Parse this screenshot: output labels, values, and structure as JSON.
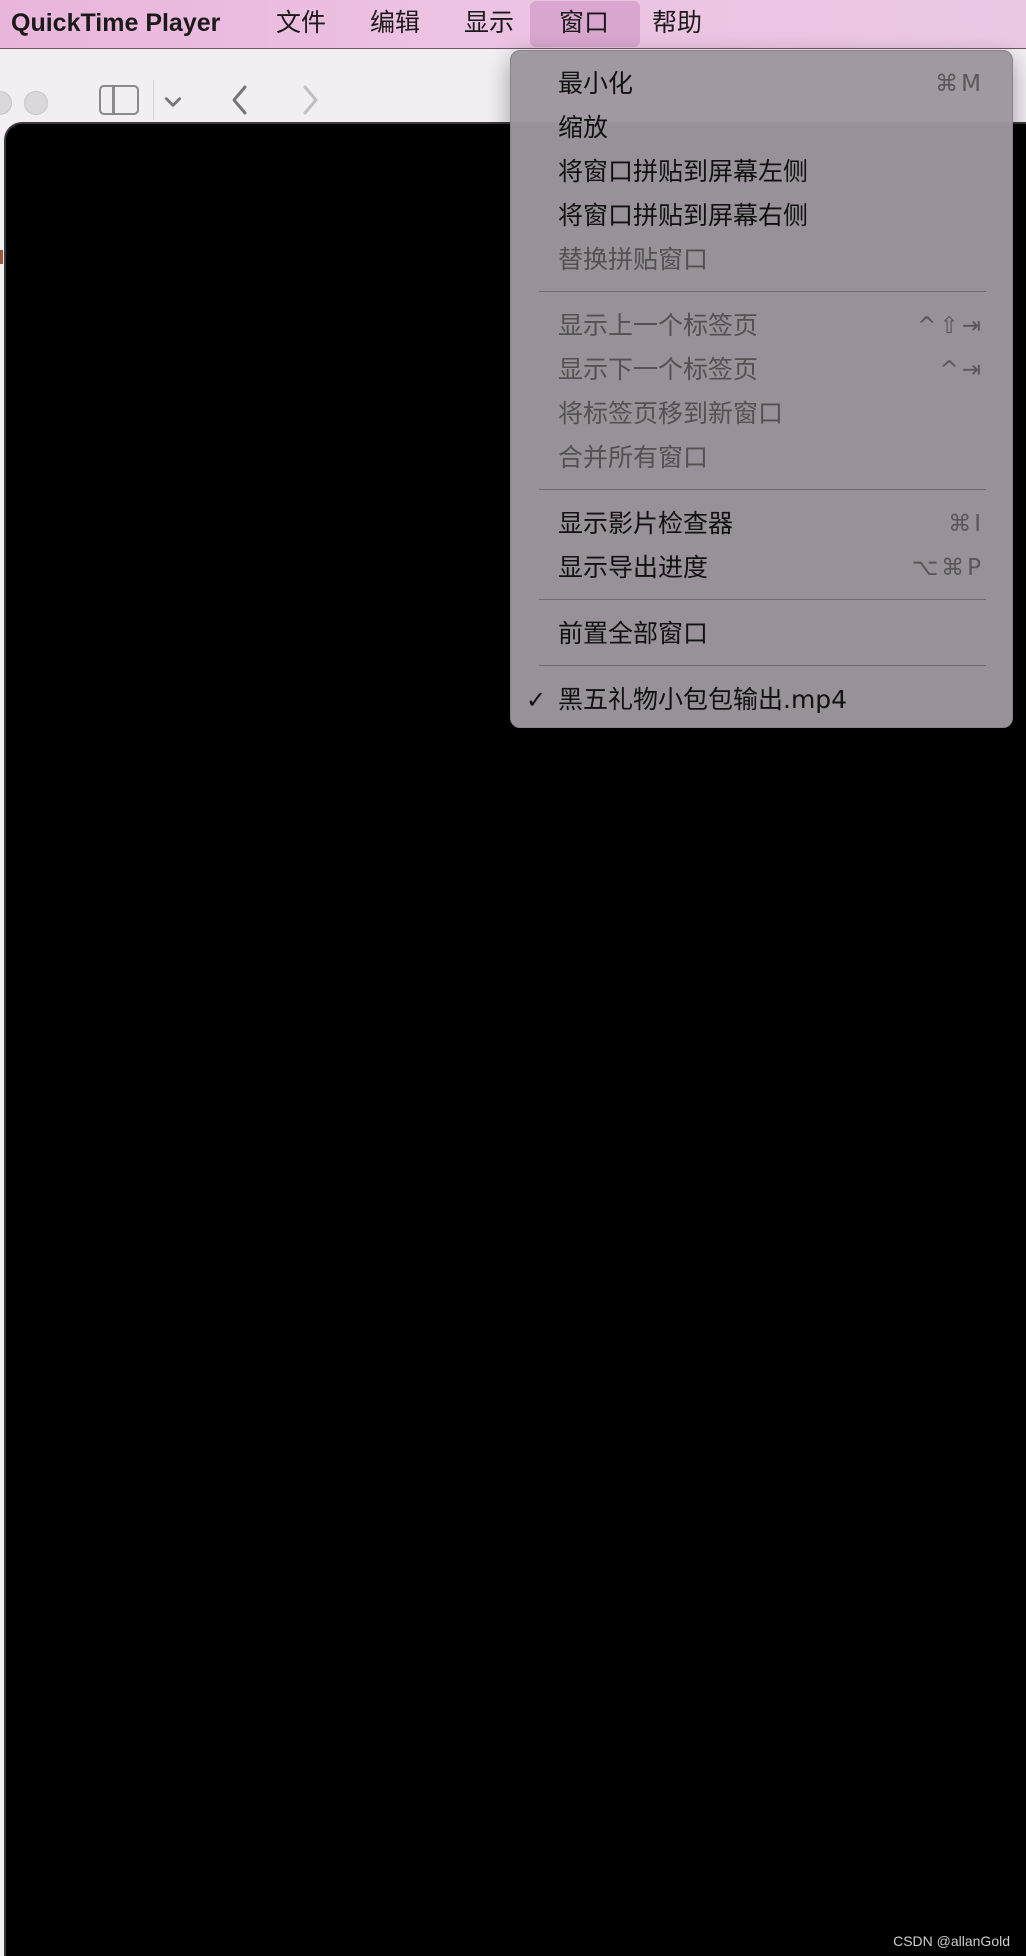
{
  "menubar": {
    "app_name": "QuickTime Player",
    "items": [
      "文件",
      "编辑",
      "显示",
      "窗口",
      "帮助"
    ],
    "active_item": "窗口"
  },
  "toolbar": {
    "icons": [
      "sidebar-toggle-icon",
      "chevron-down-icon",
      "back-arrow-icon",
      "forward-arrow-icon"
    ]
  },
  "window_menu": {
    "groups": [
      [
        {
          "label": "最小化",
          "shortcut": "⌘M",
          "enabled": true
        },
        {
          "label": "缩放",
          "shortcut": "",
          "enabled": true
        },
        {
          "label": "将窗口拼贴到屏幕左侧",
          "shortcut": "",
          "enabled": true
        },
        {
          "label": "将窗口拼贴到屏幕右侧",
          "shortcut": "",
          "enabled": true
        },
        {
          "label": "替换拼贴窗口",
          "shortcut": "",
          "enabled": false
        }
      ],
      [
        {
          "label": "显示上一个标签页",
          "shortcut": "^⇧⇥",
          "enabled": false
        },
        {
          "label": "显示下一个标签页",
          "shortcut": "^⇥",
          "enabled": false
        },
        {
          "label": "将标签页移到新窗口",
          "shortcut": "",
          "enabled": false
        },
        {
          "label": "合并所有窗口",
          "shortcut": "",
          "enabled": false
        }
      ],
      [
        {
          "label": "显示影片检查器",
          "shortcut": "⌘I",
          "enabled": true
        },
        {
          "label": "显示导出进度",
          "shortcut": "⌥⌘P",
          "enabled": true
        }
      ],
      [
        {
          "label": "前置全部窗口",
          "shortcut": "",
          "enabled": true
        }
      ],
      [
        {
          "label": "黑五礼物小包包输出.mp4",
          "shortcut": "",
          "enabled": true,
          "checked": true,
          "check_mark": "✓"
        }
      ]
    ]
  },
  "watermark": "CSDN @allanGold",
  "colors": {
    "menubar_start": "#e9b5db",
    "menubar_end": "#ebc9e5",
    "menu_bg": "#9e969e",
    "video_bg": "#000000"
  }
}
